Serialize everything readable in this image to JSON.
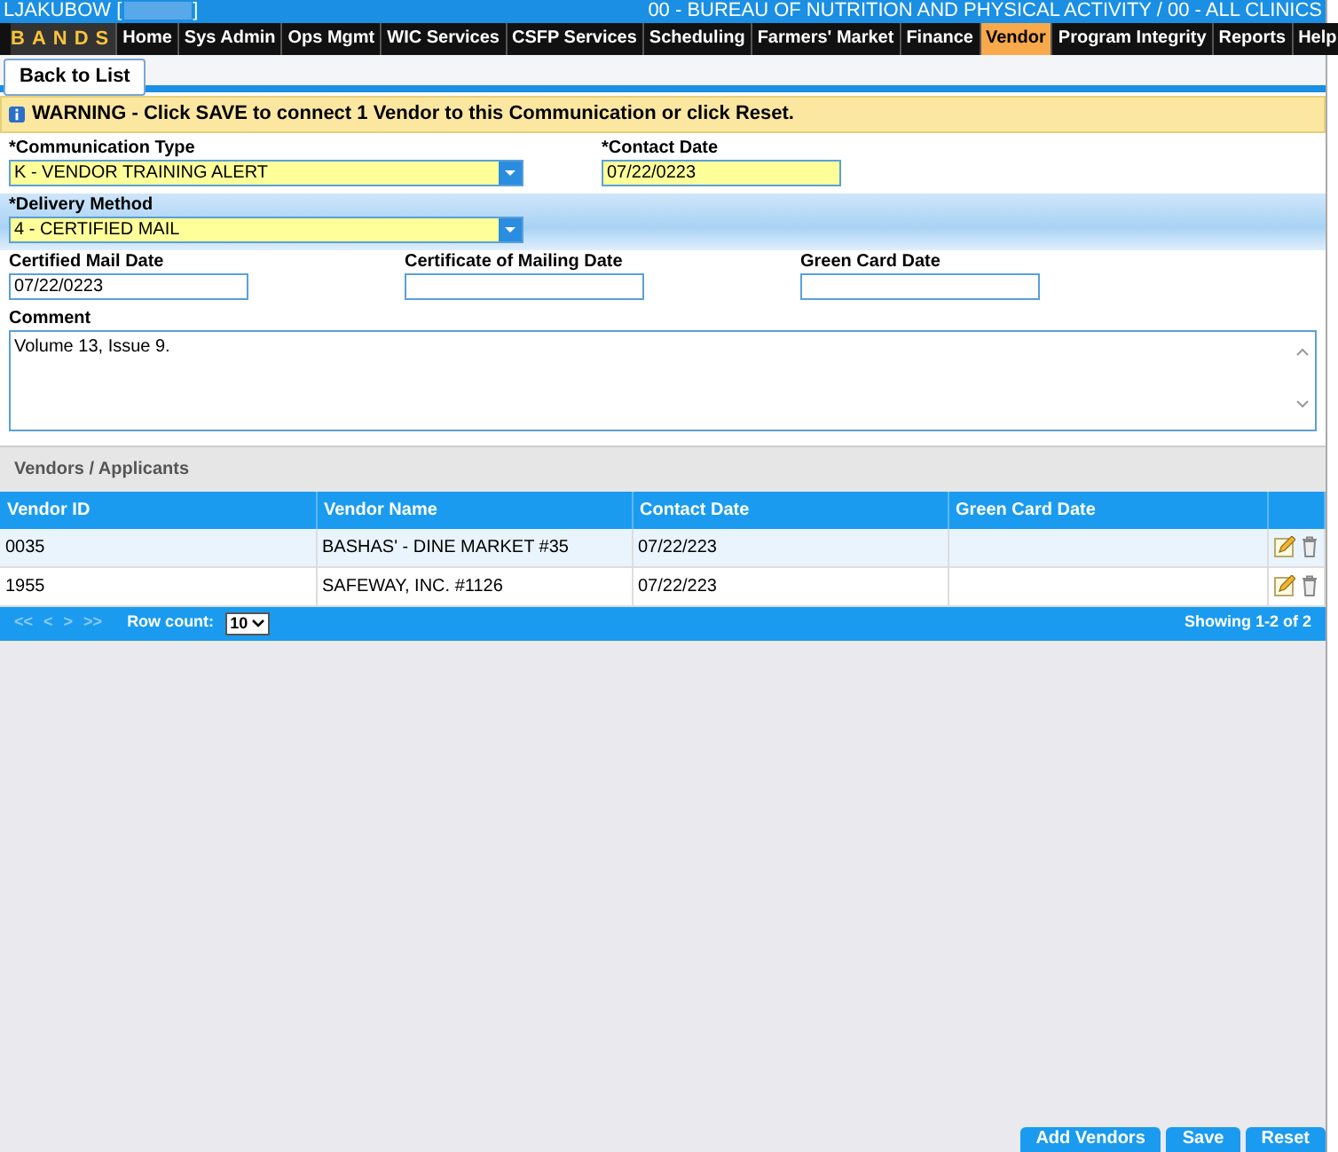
{
  "header": {
    "user": "LJAKUBOW [",
    "user_end": "]",
    "agency": "00 - BUREAU OF NUTRITION AND PHYSICAL ACTIVITY / 00 - ALL CLINICS",
    "logo": "BANDS"
  },
  "menu": [
    {
      "label": "Home",
      "selected": false
    },
    {
      "label": "Sys Admin",
      "selected": false
    },
    {
      "label": "Ops Mgmt",
      "selected": false
    },
    {
      "label": "WIC Services",
      "selected": false
    },
    {
      "label": "CSFP Services",
      "selected": false
    },
    {
      "label": "Scheduling",
      "selected": false
    },
    {
      "label": "Farmers' Market",
      "selected": false
    },
    {
      "label": "Finance",
      "selected": false
    },
    {
      "label": "Vendor",
      "selected": true
    },
    {
      "label": "Program Integrity",
      "selected": false
    },
    {
      "label": "Reports",
      "selected": false
    },
    {
      "label": "Help",
      "selected": false
    }
  ],
  "back_button": "Back to List",
  "warning": "WARNING - Click SAVE to connect 1 Vendor to this Communication or click Reset.",
  "form_rows": [
    {
      "band": false,
      "fields": [
        {
          "label": "*Communication Type",
          "value": "K - VENDOR TRAINING ALERT",
          "kind": "select",
          "required": true
        },
        {
          "label": "*Contact Date",
          "value": "07/22/0223",
          "kind": "date",
          "required": true
        }
      ]
    },
    {
      "band": true,
      "fields": [
        {
          "label": "*Delivery Method",
          "value": "4 - CERTIFIED MAIL",
          "kind": "select",
          "required": true
        }
      ]
    },
    {
      "band": false,
      "fields": [
        {
          "label": "Certified Mail Date",
          "value": "07/22/0223",
          "kind": "date",
          "required": false
        },
        {
          "label": "Certificate of Mailing Date",
          "kind": "date",
          "required": false
        },
        {
          "label": "Green Card Date",
          "kind": "date",
          "required": false
        }
      ]
    }
  ],
  "comment": {
    "label": "Comment",
    "value": "Volume 13, Issue 9."
  },
  "vendors": {
    "title": "Vendors / Applicants",
    "columns": [
      "Vendor ID",
      "Vendor Name",
      "Contact Date",
      "Green Card Date"
    ],
    "rows": [
      [
        "0035",
        "BASHAS' - DINE MARKET #35",
        "07/22/223",
        ""
      ],
      [
        "1955",
        "SAFEWAY, INC. #1126",
        "07/22/223",
        ""
      ]
    ],
    "pager": [
      "<<",
      "<",
      ">",
      ">>"
    ],
    "row_count_label": "Row count:",
    "row_count": "10",
    "showing": "Showing 1-2 of 2"
  },
  "buttons": [
    "Add Vendors",
    "Save",
    "Reset"
  ]
}
